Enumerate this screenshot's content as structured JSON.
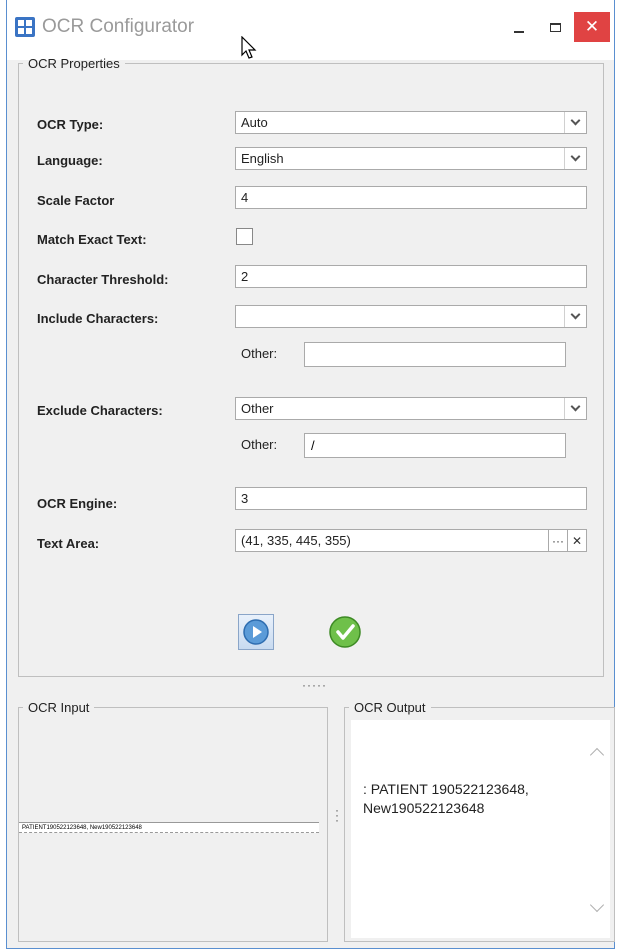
{
  "window": {
    "title": "OCR Configurator",
    "close_glyph": "✕"
  },
  "props": {
    "legend": "OCR Properties",
    "ocr_type": {
      "label": "OCR Type:",
      "value": "Auto"
    },
    "language": {
      "label": "Language:",
      "value": "English"
    },
    "scale_factor": {
      "label": "Scale Factor",
      "value": "4"
    },
    "match_exact": {
      "label": "Match Exact Text:",
      "checked": false
    },
    "char_threshold": {
      "label": "Character Threshold:",
      "value": "2"
    },
    "include_chars": {
      "label": "Include Characters:",
      "value": "",
      "other_label": "Other:",
      "other_value": ""
    },
    "exclude_chars": {
      "label": "Exclude Characters:",
      "value": "Other",
      "other_label": "Other:",
      "other_value": "/"
    },
    "ocr_engine": {
      "label": "OCR Engine:",
      "value": "3"
    },
    "text_area": {
      "label": "Text Area:",
      "value": "(41, 335, 445, 355)",
      "browse_glyph": "···",
      "clear_glyph": "✕"
    },
    "splitter_glyph": "·····"
  },
  "input": {
    "legend": "OCR Input",
    "image_text": "PATIENT190522123648, New190522123648"
  },
  "output": {
    "legend": "OCR Output",
    "text": ": PATIENT 190522123648, New190522123648"
  },
  "icons": {
    "run": "play-icon",
    "apply": "check-icon"
  }
}
